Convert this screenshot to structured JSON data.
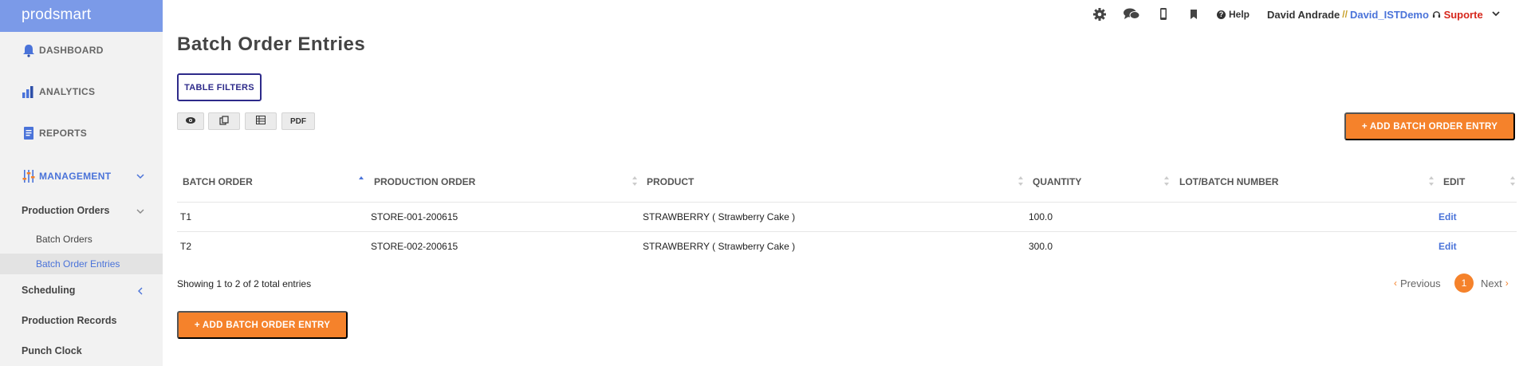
{
  "brand": {
    "logo": "prodsmart"
  },
  "sidebar": {
    "dashboard": "DASHBOARD",
    "analytics": "ANALYTICS",
    "reports": "REPORTS",
    "management": "MANAGEMENT",
    "production_orders": "Production Orders",
    "batch_orders": "Batch Orders",
    "batch_order_entries": "Batch Order Entries",
    "scheduling": "Scheduling",
    "production_records": "Production Records",
    "punch_clock": "Punch Clock"
  },
  "topbar": {
    "help": "Help",
    "user": "David Andrade",
    "separator": "//",
    "account": "David_ISTDemo",
    "support": "Suporte"
  },
  "page": {
    "title": "Batch Order Entries",
    "table_filters": "TABLE FILTERS",
    "pdf": "PDF",
    "add_entry": "+ ADD BATCH ORDER ENTRY"
  },
  "table": {
    "columns": [
      "BATCH ORDER",
      "PRODUCTION ORDER",
      "PRODUCT",
      "QUANTITY",
      "LOT/BATCH NUMBER",
      "EDIT"
    ],
    "rows": [
      {
        "batch_order": "T1",
        "production_order": "STORE-001-200615",
        "product": "STRAWBERRY ( Strawberry Cake )",
        "quantity": "100.0",
        "lot": "",
        "edit": "Edit"
      },
      {
        "batch_order": "T2",
        "production_order": "STORE-002-200615",
        "product": "STRAWBERRY ( Strawberry Cake )",
        "quantity": "300.0",
        "lot": "",
        "edit": "Edit"
      }
    ],
    "info": "Showing 1 to 2 of 2 total entries"
  },
  "pagination": {
    "previous": "Previous",
    "current": "1",
    "next": "Next"
  },
  "colors": {
    "accent": "#f5822b",
    "brand": "#7b9ae8",
    "link": "#4a73d9",
    "filter_border": "#2d2a8a",
    "support": "#d6271c"
  }
}
